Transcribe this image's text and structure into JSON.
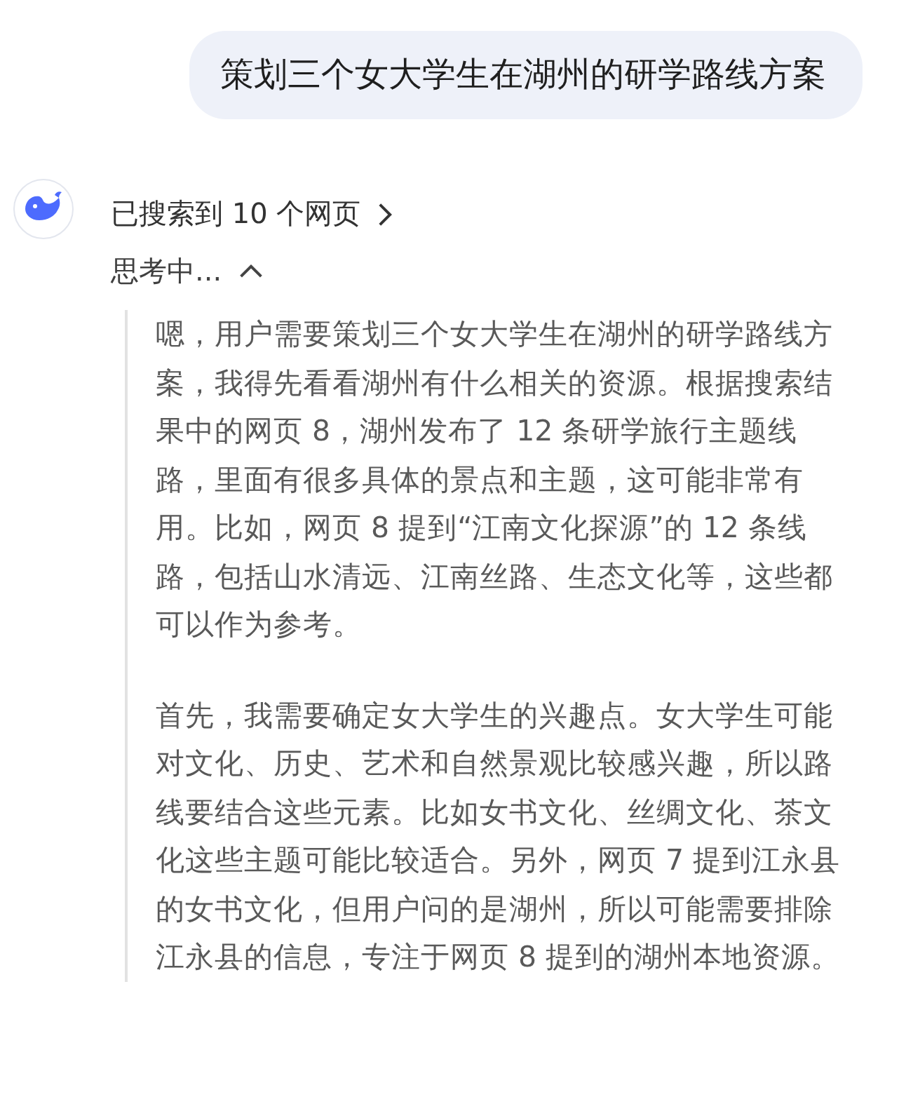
{
  "user_message": {
    "text": "策划三个女大学生在湖州的研学路线方案"
  },
  "search_status": {
    "label": "已搜索到 10 个网页"
  },
  "thinking": {
    "label": "思考中...",
    "expanded": true,
    "paragraphs": [
      "嗯，用户需要策划三个女大学生在湖州的研学路线方案，我得先看看湖州有什么相关的资源。根据搜索结果中的网页 8，湖州发布了 12 条研学旅行主题线路，里面有很多具体的景点和主题，这可能非常有用。比如，网页 8 提到“江南文化探源”的 12 条线路，包括山水清远、江南丝路、生态文化等，这些都可以作为参考。",
      "首先，我需要确定女大学生的兴趣点。女大学生可能对文化、历史、艺术和自然景观比较感兴趣，所以路线要结合这些元素。比如女书文化、丝绸文化、茶文化这些主题可能比较适合。另外，网页 7 提到江永县的女书文化，但用户问的是湖州，所以可能需要排除江永县的信息，专注于网页 8 提到的湖州本地资源。"
    ]
  }
}
